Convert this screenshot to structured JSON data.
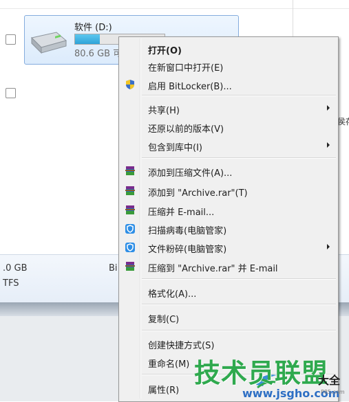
{
  "drive": {
    "name": "软件 (D:)",
    "size_text": "80.6 GB 可",
    "used_fraction": 0.28
  },
  "details": {
    "line1": ".0 GB",
    "line2": "TFS",
    "col2": "Bi"
  },
  "side_text": "侯存",
  "menu": {
    "items": [
      {
        "label": "打开(O)",
        "bold": true,
        "icon": "",
        "submenu": false
      },
      {
        "label": "在新窗口中打开(E)",
        "icon": "",
        "submenu": false
      },
      {
        "label": "启用 BitLocker(B)...",
        "icon": "shield-uac-icon",
        "submenu": false
      },
      {
        "label": "共享(H)",
        "icon": "",
        "submenu": true
      },
      {
        "label": "还原以前的版本(V)",
        "icon": "",
        "submenu": false
      },
      {
        "label": "包含到库中(I)",
        "icon": "",
        "submenu": true
      },
      {
        "label": "添加到压缩文件(A)...",
        "icon": "winrar-icon",
        "submenu": false
      },
      {
        "label": "添加到 \"Archive.rar\"(T)",
        "icon": "winrar-icon",
        "submenu": false
      },
      {
        "label": "压缩并 E-mail...",
        "icon": "winrar-icon",
        "submenu": false
      },
      {
        "label": "扫描病毒(电脑管家)",
        "icon": "pc-manager-shield-icon",
        "submenu": false
      },
      {
        "label": "文件粉碎(电脑管家)",
        "icon": "pc-manager-shield-icon",
        "submenu": true
      },
      {
        "label": "压缩到 \"Archive.rar\" 并 E-mail",
        "icon": "winrar-icon",
        "submenu": false
      },
      {
        "label": "格式化(A)...",
        "icon": "",
        "submenu": false
      },
      {
        "label": "复制(C)",
        "icon": "",
        "submenu": false
      },
      {
        "label": "创建快捷方式(S)",
        "icon": "",
        "submenu": false
      },
      {
        "label": "重命名(M)",
        "icon": "",
        "submenu": false
      },
      {
        "label": "属性(R)",
        "icon": "",
        "submenu": false
      }
    ]
  },
  "watermark": {
    "main": "技术员联盟",
    "sub": "大全",
    "url": "www.jsgho.com",
    "small": "P85.com"
  },
  "colors": {
    "menu_bg": "#f0f0f0",
    "selection_border": "#84acdd",
    "watermark_green": "#2fa94e",
    "watermark_blue": "#2e6fc4"
  }
}
